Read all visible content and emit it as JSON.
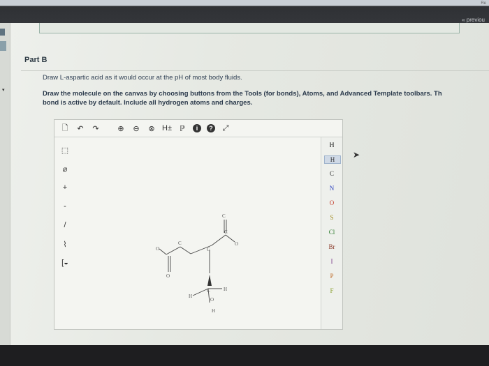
{
  "header": {
    "previous_label": "« previou",
    "corner_label": "Re"
  },
  "part": {
    "title": "Part B"
  },
  "question": {
    "line1": "Draw L-aspartic acid as it would occur at the pH of most body fluids.",
    "line2": "Draw the molecule on the canvas by choosing buttons from the Tools (for bonds), Atoms, and Advanced Template toolbars. Th",
    "line3": "bond is active by default. Include all hydrogen atoms and charges."
  },
  "toolbar": {
    "items": [
      {
        "name": "new-icon",
        "glyph": "🗋"
      },
      {
        "name": "undo-icon",
        "glyph": "↶"
      },
      {
        "name": "redo-icon",
        "glyph": "↷"
      },
      {
        "name": "zoom-in-icon",
        "glyph": "⊕"
      },
      {
        "name": "zoom-out-icon",
        "glyph": "⊖"
      },
      {
        "name": "clear-icon",
        "glyph": "⊗"
      },
      {
        "name": "hydrogen-toggle-icon",
        "glyph": "H±"
      },
      {
        "name": "template-icon",
        "glyph": "ℙ"
      },
      {
        "name": "info-icon",
        "glyph": "i"
      },
      {
        "name": "help-icon",
        "glyph": "?"
      },
      {
        "name": "expand-icon",
        "glyph": "⤢"
      }
    ]
  },
  "left_tools": [
    {
      "name": "select-icon",
      "glyph": "⬚"
    },
    {
      "name": "eraser-icon",
      "glyph": "⌀"
    },
    {
      "name": "plus-charge-icon",
      "glyph": "+"
    },
    {
      "name": "minus-charge-icon",
      "glyph": "-"
    },
    {
      "name": "single-bond-icon",
      "glyph": "/"
    },
    {
      "name": "chain-icon",
      "glyph": "⌇"
    },
    {
      "name": "ring-template-icon",
      "glyph": "[◒"
    }
  ],
  "atoms": {
    "header": "ℍ",
    "list": [
      "H",
      "C",
      "N",
      "O",
      "S",
      "Cl",
      "Br",
      "I",
      "P",
      "F"
    ],
    "selected": "H",
    "colors": {
      "H": "#333333",
      "C": "#333333",
      "N": "#2a3fbf",
      "O": "#c43b2a",
      "S": "#a08a20",
      "Cl": "#2b7a2b",
      "Br": "#8a3a2a",
      "I": "#7a3a8a",
      "P": "#c07030",
      "F": "#8aa030"
    }
  },
  "molecule": {
    "atom_labels": [
      "O",
      "O",
      "C",
      "C",
      "C",
      "C",
      "O",
      "O",
      "H",
      "C",
      "H",
      "H"
    ]
  }
}
